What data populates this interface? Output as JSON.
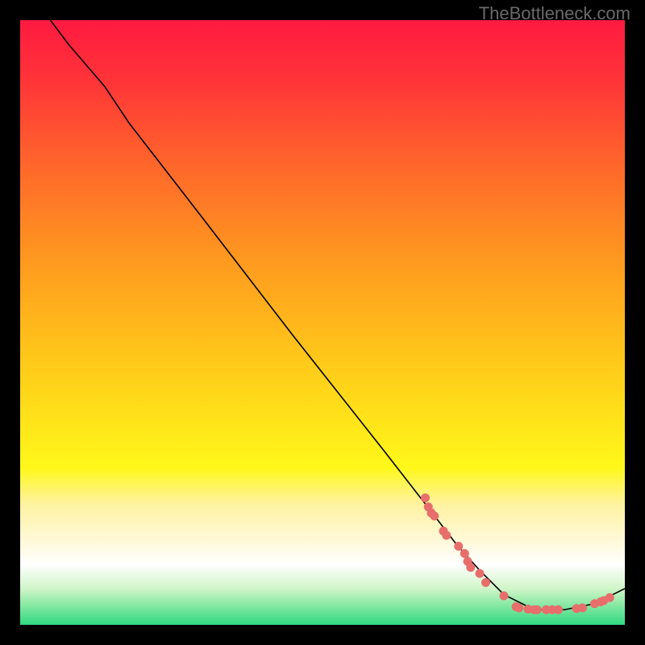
{
  "watermark": "TheBottleneck.com",
  "chart_data": {
    "type": "line",
    "title": "",
    "xlabel": "",
    "ylabel": "",
    "xlim": [
      0,
      100
    ],
    "ylim": [
      0,
      100
    ],
    "background_gradient_stops": [
      {
        "offset": 0.0,
        "color": "#ff1a41"
      },
      {
        "offset": 0.1,
        "color": "#ff3438"
      },
      {
        "offset": 0.25,
        "color": "#ff6a2a"
      },
      {
        "offset": 0.4,
        "color": "#ff9a1f"
      },
      {
        "offset": 0.55,
        "color": "#ffc51a"
      },
      {
        "offset": 0.68,
        "color": "#ffe81a"
      },
      {
        "offset": 0.74,
        "color": "#fff81a"
      },
      {
        "offset": 0.8,
        "color": "#fff2a0"
      },
      {
        "offset": 0.86,
        "color": "#fff9d8"
      },
      {
        "offset": 0.9,
        "color": "#ffffff"
      },
      {
        "offset": 0.94,
        "color": "#d0f5c8"
      },
      {
        "offset": 0.97,
        "color": "#7fe7a0"
      },
      {
        "offset": 1.0,
        "color": "#30d880"
      }
    ],
    "curve_points": [
      {
        "x": 5.0,
        "y": 100.0
      },
      {
        "x": 8.0,
        "y": 96.0
      },
      {
        "x": 11.0,
        "y": 92.5
      },
      {
        "x": 14.0,
        "y": 89.0
      },
      {
        "x": 18.0,
        "y": 83.0
      },
      {
        "x": 30.0,
        "y": 67.5
      },
      {
        "x": 45.0,
        "y": 48.0
      },
      {
        "x": 60.0,
        "y": 29.0
      },
      {
        "x": 67.0,
        "y": 20.0
      },
      {
        "x": 72.0,
        "y": 13.5
      },
      {
        "x": 76.0,
        "y": 9.0
      },
      {
        "x": 80.0,
        "y": 5.0
      },
      {
        "x": 85.0,
        "y": 2.5
      },
      {
        "x": 90.0,
        "y": 2.5
      },
      {
        "x": 95.0,
        "y": 3.5
      },
      {
        "x": 100.0,
        "y": 6.0
      }
    ],
    "marker_points": [
      {
        "x": 67.0,
        "y": 21.0
      },
      {
        "x": 67.5,
        "y": 19.5
      },
      {
        "x": 68.0,
        "y": 18.5
      },
      {
        "x": 68.5,
        "y": 18.0
      },
      {
        "x": 70.0,
        "y": 15.5
      },
      {
        "x": 70.5,
        "y": 14.8
      },
      {
        "x": 72.5,
        "y": 13.0
      },
      {
        "x": 73.5,
        "y": 11.8
      },
      {
        "x": 74.0,
        "y": 10.5
      },
      {
        "x": 74.5,
        "y": 9.5
      },
      {
        "x": 76.0,
        "y": 8.5
      },
      {
        "x": 77.0,
        "y": 7.0
      },
      {
        "x": 80.0,
        "y": 4.8
      },
      {
        "x": 82.0,
        "y": 3.0
      },
      {
        "x": 82.5,
        "y": 2.8
      },
      {
        "x": 84.0,
        "y": 2.6
      },
      {
        "x": 85.0,
        "y": 2.5
      },
      {
        "x": 85.5,
        "y": 2.5
      },
      {
        "x": 87.0,
        "y": 2.5
      },
      {
        "x": 88.0,
        "y": 2.5
      },
      {
        "x": 89.0,
        "y": 2.5
      },
      {
        "x": 92.0,
        "y": 2.7
      },
      {
        "x": 93.0,
        "y": 2.8
      },
      {
        "x": 95.0,
        "y": 3.5
      },
      {
        "x": 96.0,
        "y": 3.8
      },
      {
        "x": 96.5,
        "y": 4.0
      },
      {
        "x": 97.5,
        "y": 4.5
      }
    ],
    "marker_color": "#e76e6b",
    "curve_color": "#000000"
  }
}
